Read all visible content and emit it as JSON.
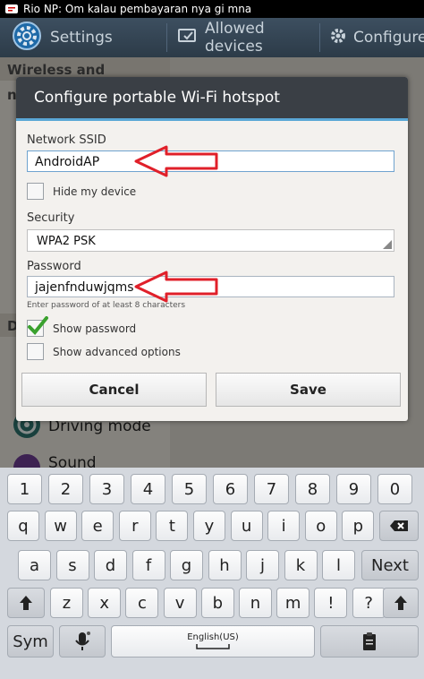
{
  "status_bar": {
    "notification": "Rio NP: Om kalau pembayaran nya gi mna"
  },
  "action_bar": {
    "settings_label": "Settings",
    "allowed_devices_label": "Allowed devices",
    "configure_label": "Configure"
  },
  "background": {
    "section_header": "Wireless and networks",
    "section2_header": "D",
    "driving_mode_label": "Driving mode",
    "sound_label": "Sound"
  },
  "dialog": {
    "title": "Configure portable Wi-Fi hotspot",
    "ssid_label": "Network SSID",
    "ssid_value": "AndroidAP",
    "hide_device_label": "Hide my device",
    "hide_device_checked": false,
    "security_label": "Security",
    "security_value": "WPA2 PSK",
    "password_label": "Password",
    "password_value": "jajenfnduwjqms",
    "password_hint": "Enter password of at least 8 characters",
    "show_password_label": "Show password",
    "show_password_checked": true,
    "advanced_label": "Show advanced options",
    "advanced_checked": false,
    "cancel_label": "Cancel",
    "save_label": "Save"
  },
  "annotation": {
    "arrow_color": "#e0202a"
  },
  "keyboard": {
    "row1": [
      "1",
      "2",
      "3",
      "4",
      "5",
      "6",
      "7",
      "8",
      "9",
      "0"
    ],
    "row2": [
      "q",
      "w",
      "e",
      "r",
      "t",
      "y",
      "u",
      "i",
      "o",
      "p"
    ],
    "row3": [
      "a",
      "s",
      "d",
      "f",
      "g",
      "h",
      "j",
      "k",
      "l"
    ],
    "row3_action": "Next",
    "row4": [
      "z",
      "x",
      "c",
      "v",
      "b",
      "n",
      "m",
      "!",
      "?"
    ],
    "sym_label": "Sym",
    "language_label": "English(US)"
  },
  "colors": {
    "accent": "#5aa7d6",
    "check_green": "#3aa12e"
  }
}
